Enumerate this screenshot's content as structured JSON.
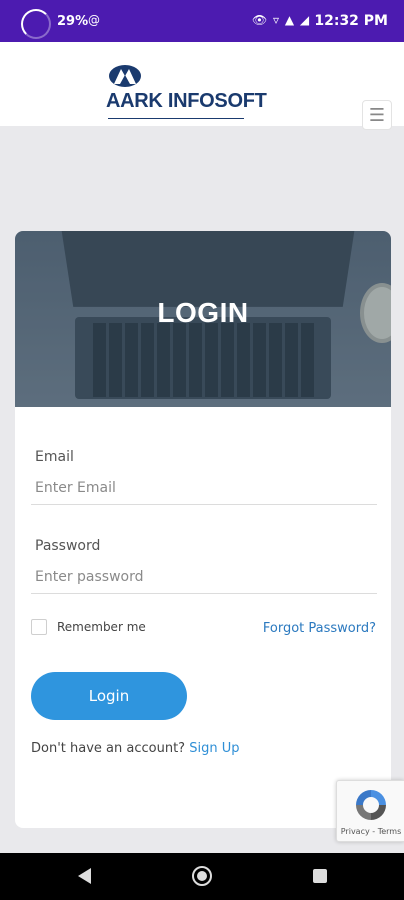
{
  "status_bar": {
    "battery": "29%",
    "notification_icon": "at-circle-icon",
    "right_icons": "👁 ▿ ▲ ◢",
    "time": "12:32 PM"
  },
  "header": {
    "logo_text": "AARK INFOSOFT",
    "menu_icon": "☰"
  },
  "hero": {
    "title": "LOGIN"
  },
  "form": {
    "email_label": "Email",
    "email_placeholder": "Enter Email",
    "password_label": "Password",
    "password_placeholder": "Enter password",
    "remember_label": "Remember me",
    "forgot_label": "Forgot Password?",
    "login_label": "Login",
    "signup_prompt": "Don't have an account?",
    "signup_link": "Sign Up"
  },
  "recaptcha": {
    "text": "Privacy - Terms"
  },
  "colors": {
    "status_bar": "#4c1bb0",
    "accent": "#2f95de",
    "link": "#2b79bf",
    "logo": "#1a3a6e"
  }
}
